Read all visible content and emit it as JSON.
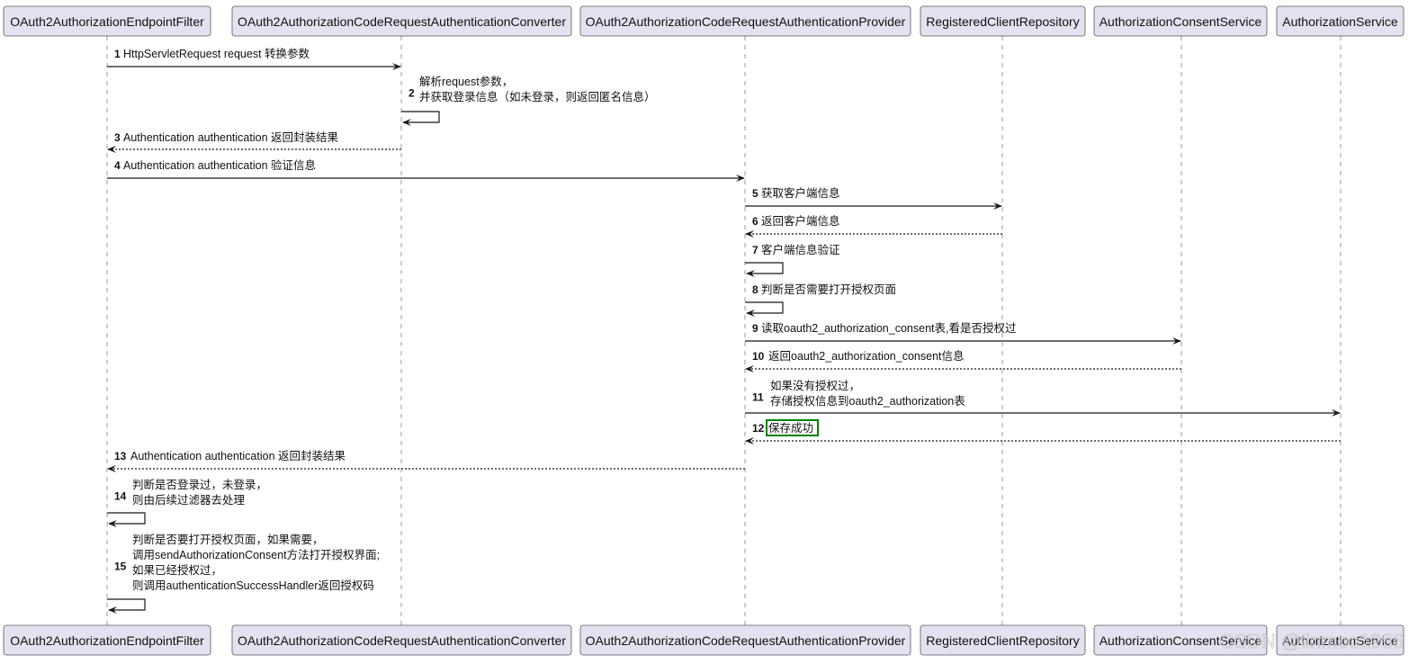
{
  "participants": [
    "OAuth2AuthorizationEndpointFilter",
    "OAuth2AuthorizationCodeRequestAuthenticationConverter",
    "OAuth2AuthorizationCodeRequestAuthenticationProvider",
    "RegisteredClientRepository",
    "AuthorizationConsentService",
    "AuthorizationService"
  ],
  "messages": [
    {
      "num": "1",
      "from": 0,
      "to": 1,
      "type": "sync",
      "lines": [
        "HttpServletRequest request 转换参数"
      ]
    },
    {
      "num": "2",
      "from": 1,
      "to": 1,
      "type": "self",
      "lines": [
        "解析request参数，",
        "并获取登录信息（如未登录，则返回匿名信息）"
      ]
    },
    {
      "num": "3",
      "from": 1,
      "to": 0,
      "type": "return",
      "lines": [
        "Authentication authentication 返回封装结果"
      ]
    },
    {
      "num": "4",
      "from": 0,
      "to": 2,
      "type": "sync",
      "lines": [
        "Authentication authentication 验证信息"
      ]
    },
    {
      "num": "5",
      "from": 2,
      "to": 3,
      "type": "sync",
      "lines": [
        "获取客户端信息"
      ]
    },
    {
      "num": "6",
      "from": 3,
      "to": 2,
      "type": "return",
      "lines": [
        "返回客户端信息"
      ]
    },
    {
      "num": "7",
      "from": 2,
      "to": 2,
      "type": "self",
      "lines": [
        "客户端信息验证"
      ]
    },
    {
      "num": "8",
      "from": 2,
      "to": 2,
      "type": "self",
      "lines": [
        "判断是否需要打开授权页面"
      ]
    },
    {
      "num": "9",
      "from": 2,
      "to": 4,
      "type": "sync",
      "lines": [
        "读取oauth2_authorization_consent表,看是否授权过"
      ]
    },
    {
      "num": "10",
      "from": 4,
      "to": 2,
      "type": "return",
      "lines": [
        "返回oauth2_authorization_consent信息"
      ]
    },
    {
      "num": "11",
      "from": 2,
      "to": 5,
      "type": "sync",
      "lines": [
        "如果没有授权过，",
        "存储授权信息到oauth2_authorization表"
      ]
    },
    {
      "num": "12",
      "from": 5,
      "to": 2,
      "type": "return",
      "highlight": true,
      "lines": [
        "保存成功"
      ]
    },
    {
      "num": "13",
      "from": 2,
      "to": 0,
      "type": "return",
      "lines": [
        "Authentication authentication 返回封装结果"
      ]
    },
    {
      "num": "14",
      "from": 0,
      "to": 0,
      "type": "self",
      "lines": [
        "判断是否登录过，未登录，",
        "则由后续过滤器去处理"
      ]
    },
    {
      "num": "15",
      "from": 0,
      "to": 0,
      "type": "self",
      "lines": [
        "判断是否要打开授权页面，如果需要，",
        "调用sendAuthorizationConsent方法打开授权界面;",
        "如果已经授权过，",
        "则调用authenticationSuccessHandler返回授权码"
      ]
    }
  ],
  "highlight_color": "#008000",
  "participant_fill": "#E2E2F0",
  "watermark": "CSDN @linmoo1986"
}
